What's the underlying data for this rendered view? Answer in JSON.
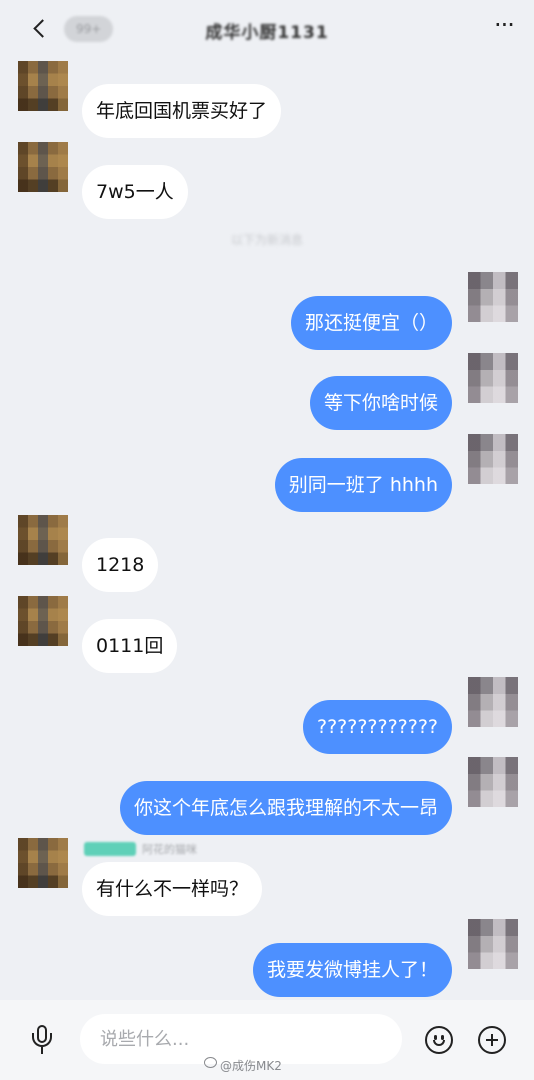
{
  "header": {
    "badge": "99+",
    "title": "成华小厨1131",
    "more_icon": "ellipsis-icon"
  },
  "faint_hint": "以下为新消息",
  "messages": [
    {
      "side": "in",
      "text": "年底回国机票买好了"
    },
    {
      "side": "in",
      "text": "7w5一人"
    },
    {
      "side": "out",
      "text": "那还挺便宜（）"
    },
    {
      "side": "out",
      "text": "等下你啥时候"
    },
    {
      "side": "out",
      "text": "别同一班了 hhhh"
    },
    {
      "side": "in",
      "text": "1218"
    },
    {
      "side": "in",
      "text": "0111回"
    },
    {
      "side": "out",
      "text": "????????????"
    },
    {
      "side": "out",
      "text": "你这个年底怎么跟我理解的不太一昂"
    },
    {
      "side": "in",
      "text": "有什么不一样吗？"
    },
    {
      "side": "out",
      "text": "我要发微博挂人了！"
    }
  ],
  "sender_label": {
    "tag": "群主",
    "name": "阿花的猫咪"
  },
  "input": {
    "placeholder": "说些什么..."
  },
  "watermark": "@成伤MK2",
  "colors": {
    "background": "#eef0f4",
    "outgoing_bubble": "#4d90ff",
    "incoming_bubble": "#ffffff"
  }
}
